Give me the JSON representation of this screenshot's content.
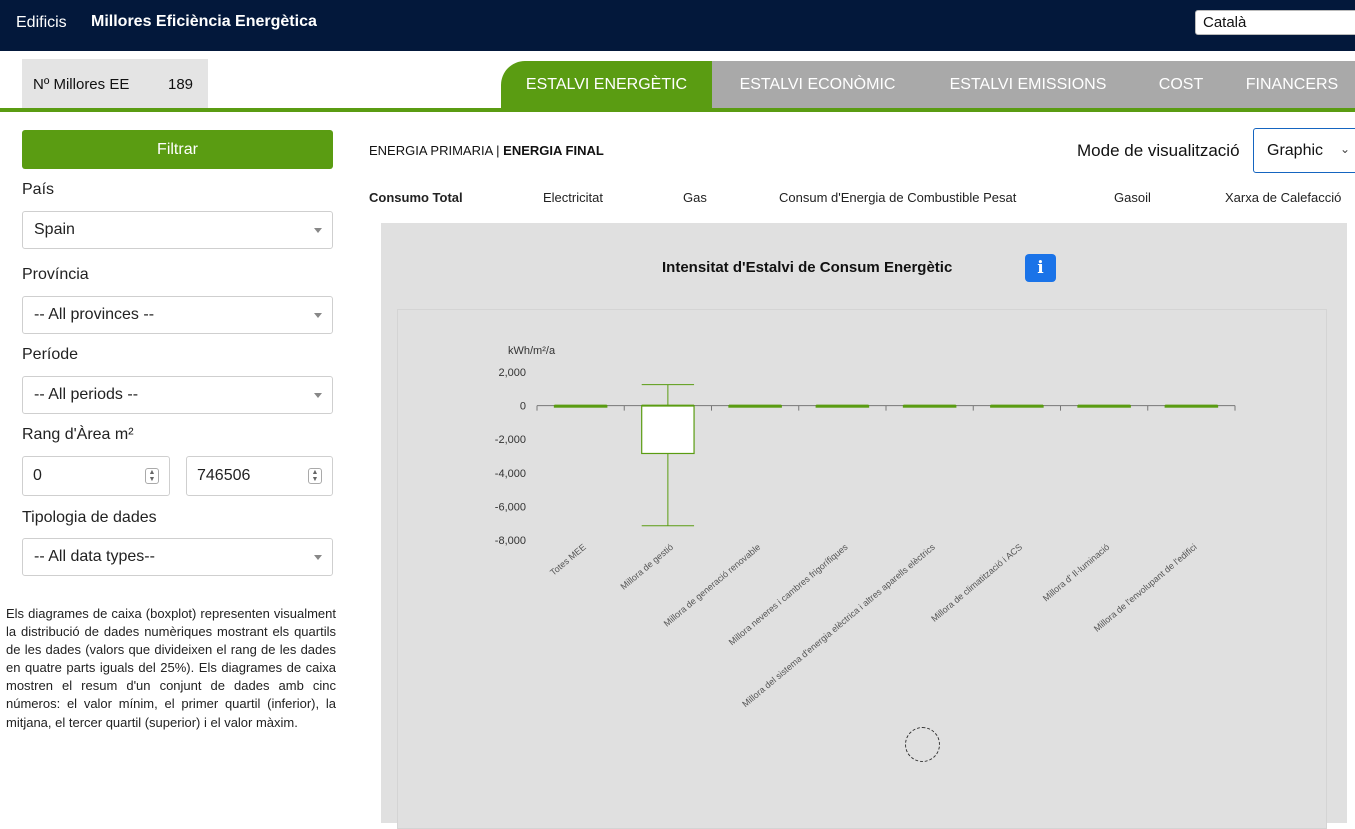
{
  "header": {
    "brand": "Edificis",
    "title": "Millores Eficiència Energètica",
    "language": "Català"
  },
  "counter": {
    "label": "Nº Millores EE",
    "value": "189"
  },
  "tabs": [
    {
      "label": "ESTALVI ENERGÈTIC",
      "active": true
    },
    {
      "label": "ESTALVI ECONÒMIC",
      "active": false
    },
    {
      "label": "ESTALVI EMISSIONS",
      "active": false
    },
    {
      "label": "COST",
      "active": false
    },
    {
      "label": "FINANCERS",
      "active": false
    }
  ],
  "filters": {
    "button": "Filtrar",
    "country_label": "País",
    "country_value": "Spain",
    "province_label": "Província",
    "province_value": "-- All provinces --",
    "period_label": "Període",
    "period_value": "-- All periods --",
    "area_label": "Rang d'Àrea m²",
    "area_min": "0",
    "area_max": "746506",
    "data_type_label": "Tipologia de dades",
    "data_type_value": "-- All data types--"
  },
  "description": "Els diagrames de caixa (boxplot) representen visualment la distribució de dades numèriques mostrant els quartils de les dades (valors que divideixen el rang de les dades en quatre parts iguals del 25%). Els diagrames de caixa mostren el resum d'un conjunt de dades amb cinc números: el valor mínim, el primer quartil (inferior), la mitjana, el tercer quartil (superior) i el valor màxim.",
  "energy_mode": {
    "primary": "ENERGIA PRIMARIA",
    "separator": " | ",
    "final": "ENERGIA FINAL"
  },
  "visualization": {
    "label": "Mode de visualització",
    "value": "Graphic"
  },
  "subtabs": [
    {
      "label": "Consumo Total",
      "active": true
    },
    {
      "label": "Electricitat",
      "active": false
    },
    {
      "label": "Gas",
      "active": false
    },
    {
      "label": "Consum d'Energia de Combustible Pesat",
      "active": false
    },
    {
      "label": "Gasoil",
      "active": false
    },
    {
      "label": "Xarxa de Calefacció",
      "active": false
    }
  ],
  "chart_data": {
    "type": "boxplot",
    "title": "Intensitat d'Estalvi de Consum Energètic",
    "ylabel": "kWh/m²/a",
    "ylim": [
      -8000,
      2000
    ],
    "yticks": [
      2000,
      0,
      -2000,
      -4000,
      -6000,
      -8000
    ],
    "ytick_labels": [
      "2,000",
      "0",
      "-2,000",
      "-4,000",
      "-6,000",
      "-8,000"
    ],
    "color": "#5a9c12",
    "categories": [
      "Totes MEE",
      "Millora de gestió",
      "Millora de generació renovable",
      "Millora neveres i cambres frigorífiques",
      "Millora del sistema d'energia elèctrica i altres aparells elèctrics",
      "Millora de climatització i ACS",
      "Millora d' Il·luminació",
      "Millora de l'envolupant de l'edifici"
    ],
    "boxes": [
      {
        "min": -40,
        "q1": -20,
        "median": 0,
        "q3": 0,
        "max": 0
      },
      {
        "min": -7150,
        "q1": -2850,
        "median": 0,
        "q3": 0,
        "max": 1250
      },
      {
        "min": -15,
        "q1": -10,
        "median": 0,
        "q3": 0,
        "max": 0
      },
      {
        "min": -10,
        "q1": -5,
        "median": 0,
        "q3": 0,
        "max": 0
      },
      {
        "min": -5,
        "q1": -3,
        "median": 0,
        "q3": 0,
        "max": 0
      },
      {
        "min": -50,
        "q1": -30,
        "median": 0,
        "q3": 0,
        "max": 0
      },
      {
        "min": -30,
        "q1": -15,
        "median": 0,
        "q3": 0,
        "max": 0
      },
      {
        "min": -10,
        "q1": -5,
        "median": 0,
        "q3": 0,
        "max": 0
      }
    ]
  }
}
